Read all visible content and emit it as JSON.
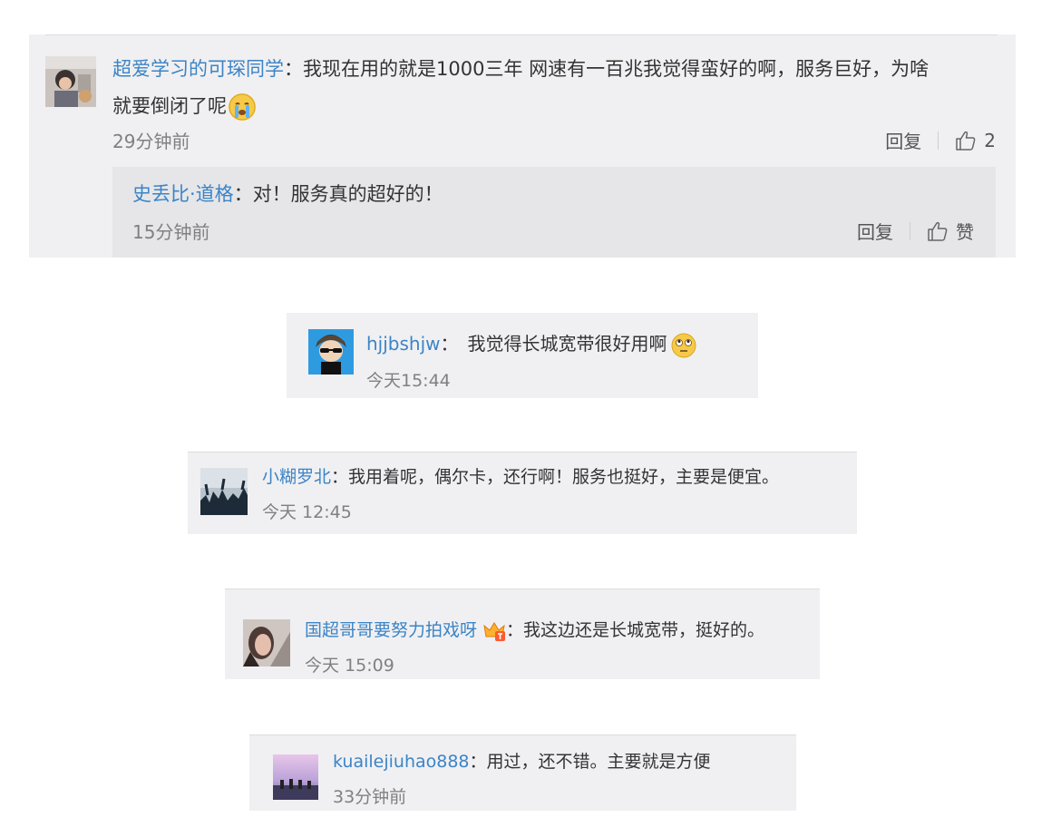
{
  "comment1": {
    "username": "超爱学习的可琛同学",
    "separator": "：",
    "text_line1": "我现在用的就是1000三年  网速有一百兆我觉得蛮好的啊，服务巨好，为啥",
    "text_line2": "就要倒闭了呢",
    "time": "29分钟前",
    "reply_label": "回复",
    "like_count": "2",
    "emoji": "crying-face-icon"
  },
  "reply1": {
    "username": "史丢比·道格",
    "separator": "：",
    "text": "对！服务真的超好的！",
    "time": "15分钟前",
    "reply_label": "回复",
    "like_label": "赞"
  },
  "comment2": {
    "username": "hjjbshjw",
    "separator": "：",
    "text": "我觉得长城宽带很好用啊",
    "time": "今天15:44",
    "emoji": "rolling-eyes-face-icon"
  },
  "comment3": {
    "username": "小糊罗北",
    "separator": "：",
    "text": "我用着呢，偶尔卡，还行啊！服务也挺好，主要是便宜。",
    "time": "今天 12:45"
  },
  "comment4": {
    "username": "国超哥哥要努力拍戏呀",
    "separator": "：",
    "text": "我这边还是长城宽带，挺好的。",
    "time": "今天 15:09",
    "badge": "vip-badge-icon"
  },
  "comment5": {
    "username": "kuailejiuhao888",
    "separator": "：",
    "text": "用过，还不错。主要就是方便",
    "time": "33分钟前"
  },
  "colors": {
    "username": "#3c84c6",
    "card_background": "#f0f0f2",
    "reply_background": "#e6e6e9"
  }
}
